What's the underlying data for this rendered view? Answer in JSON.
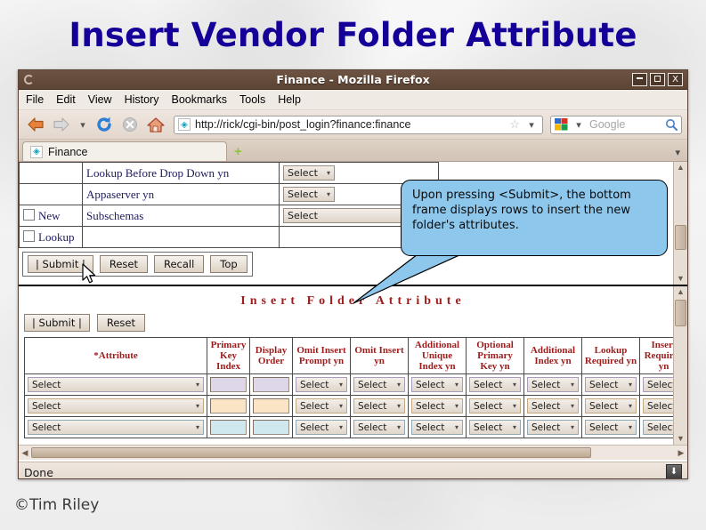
{
  "slide": {
    "title": "Insert Vendor Folder Attribute",
    "footer": "©Tim Riley",
    "title_color": "#140099"
  },
  "window": {
    "title": "Finance - Mozilla Firefox",
    "minimize_label": "Minimize",
    "maximize_label": "Maximize",
    "close_label": "X"
  },
  "menu": {
    "items": [
      {
        "label": "File",
        "accel": "F"
      },
      {
        "label": "Edit",
        "accel": "E"
      },
      {
        "label": "View",
        "accel": "V"
      },
      {
        "label": "History",
        "accel": "s"
      },
      {
        "label": "Bookmarks",
        "accel": "B"
      },
      {
        "label": "Tools",
        "accel": "T"
      },
      {
        "label": "Help",
        "accel": "H"
      }
    ]
  },
  "toolbar": {
    "back_icon": "back-arrow-icon",
    "forward_icon": "forward-arrow-icon",
    "history_icon": "chevron-down-icon",
    "reload_icon": "reload-icon",
    "stop_icon": "stop-icon",
    "home_icon": "home-icon",
    "url": "http://rick/cgi-bin/post_login?finance:finance",
    "url_favicon": "site-favicon",
    "bookmark_icon": "star-icon",
    "url_dropdown_icon": "chevron-down-icon",
    "search_engine": "google-icon",
    "search_placeholder": "Google",
    "search_value": "",
    "search_icon": "magnifier-icon"
  },
  "tabs": {
    "items": [
      {
        "label": "Finance",
        "favicon": "site-favicon",
        "active": true
      }
    ],
    "new_tab_label": "+",
    "list_all_icon": "chevron-down-icon"
  },
  "top_frame": {
    "rows": [
      {
        "checkbox": null,
        "checkbox_label": "",
        "label": "Lookup Before Drop Down yn",
        "control": "select",
        "value": "Select"
      },
      {
        "checkbox": null,
        "checkbox_label": "",
        "label": "Appaserver yn",
        "control": "select",
        "value": "Select"
      },
      {
        "checkbox": false,
        "checkbox_label": "New",
        "label": "Subschemas",
        "control": "select-wide",
        "value": "Select"
      },
      {
        "checkbox": false,
        "checkbox_label": "Lookup",
        "label": "",
        "control": "none",
        "value": ""
      }
    ],
    "buttons": [
      "|  Submit  |",
      "Reset",
      "Recall",
      "Top"
    ]
  },
  "bottom_frame": {
    "heading": "Insert Folder Attribute",
    "buttons": [
      "|  Submit  |",
      "Reset"
    ],
    "columns": [
      "*Attribute",
      "Primary Key Index",
      "Display Order",
      "Omit Insert Prompt yn",
      "Omit Insert yn",
      "Additional Unique Index yn",
      "Optional Primary Key yn",
      "Additional Index yn",
      "Lookup Required yn",
      "Insert Required yn"
    ],
    "column_types": [
      "select",
      "text",
      "text",
      "select",
      "select",
      "select",
      "select",
      "select",
      "select",
      "select"
    ],
    "select_placeholder": "Select",
    "rows": [
      {
        "tint": "#ded7ea",
        "values": [
          "Select",
          "",
          "",
          "Select",
          "Select",
          "Select",
          "Select",
          "Select",
          "Select",
          "Select"
        ]
      },
      {
        "tint": "#fbe3c6",
        "values": [
          "Select",
          "",
          "",
          "Select",
          "Select",
          "Select",
          "Select",
          "Select",
          "Select",
          "Select"
        ]
      },
      {
        "tint": "#cfe7ef",
        "values": [
          "Select",
          "",
          "",
          "Select",
          "Select",
          "Select",
          "Select",
          "Select",
          "Select",
          "Select"
        ]
      }
    ]
  },
  "callout": {
    "text": "Upon pressing <Submit>, the bottom frame displays rows to insert the new folder's attributes.",
    "fill": "#8ec7ec"
  },
  "status": {
    "text": "Done",
    "download_icon": "download-arrow-icon"
  }
}
